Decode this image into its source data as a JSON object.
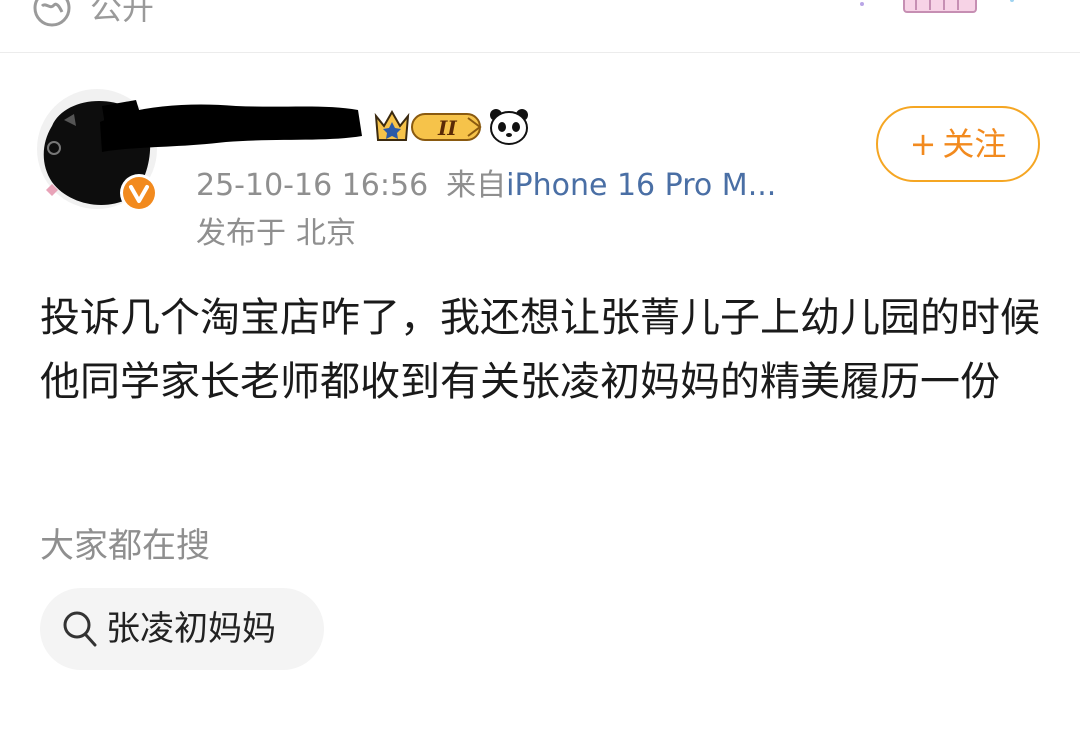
{
  "header": {
    "visibility_label": "公开",
    "visibility_icon": "globe-icon"
  },
  "post": {
    "author": {
      "avatar_icon": "avatar",
      "verified_icon": "verified-v-icon",
      "level_badge": "II",
      "badge_icons": [
        "crown-icon",
        "panda-icon"
      ]
    },
    "timestamp": "25-10-16 16:56",
    "source_prefix": "来自",
    "device": "iPhone 16 Pro M...",
    "location_prefix": "发布于",
    "location": "北京",
    "follow_plus": "+",
    "follow_label": "关注",
    "content": "投诉几个淘宝店咋了，我还想让张菁儿子上幼儿园的时候他同学家长老师都收到有关张凌初妈妈的精美履历一份"
  },
  "search": {
    "heading": "大家都在搜",
    "chip_label": "张凌初妈妈",
    "chip_icon": "search-icon"
  },
  "colors": {
    "accent_orange": "#f28a1e",
    "follow_border": "#f5a623",
    "link_blue": "#4a6fa5",
    "muted_text": "#8f8f8f",
    "body_text": "#1a1a1a",
    "chip_bg": "#f4f4f4"
  }
}
